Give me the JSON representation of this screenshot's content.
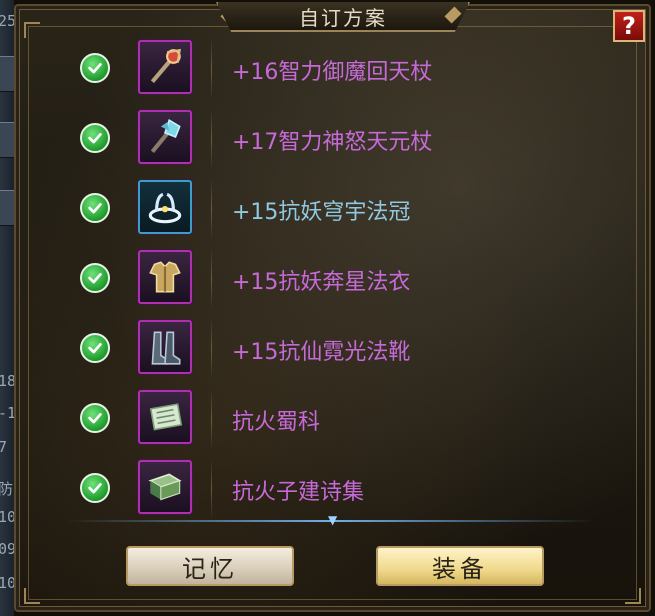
{
  "dialog": {
    "title": "自订方案",
    "help_label": "?"
  },
  "items": [
    {
      "name": "+16智力御魔回天杖",
      "icon": "staff-icon",
      "rarity_color": "#c66ad8",
      "checked": true
    },
    {
      "name": "+17智力神怒天元杖",
      "icon": "crystal-staff-icon",
      "rarity_color": "#c66ad8",
      "checked": true
    },
    {
      "name": "+15抗妖穹宇法冠",
      "icon": "crown-icon",
      "rarity_color": "#8fc8e0",
      "checked": true
    },
    {
      "name": "+15抗妖奔星法衣",
      "icon": "robe-icon",
      "rarity_color": "#c66ad8",
      "checked": true
    },
    {
      "name": "+15抗仙霓光法靴",
      "icon": "boots-icon",
      "rarity_color": "#c66ad8",
      "checked": true
    },
    {
      "name": "抗火蜀科",
      "icon": "scroll-icon",
      "rarity_color": "#c66ad8",
      "checked": true
    },
    {
      "name": "抗火子建诗集",
      "icon": "book-icon",
      "rarity_color": "#c66ad8",
      "checked": true
    }
  ],
  "buttons": {
    "memory_label": "记忆",
    "equip_label": "装备"
  },
  "left_sliver": [
    "25",
    "18",
    "-1",
    "7",
    "防",
    "10",
    "09",
    "10"
  ]
}
